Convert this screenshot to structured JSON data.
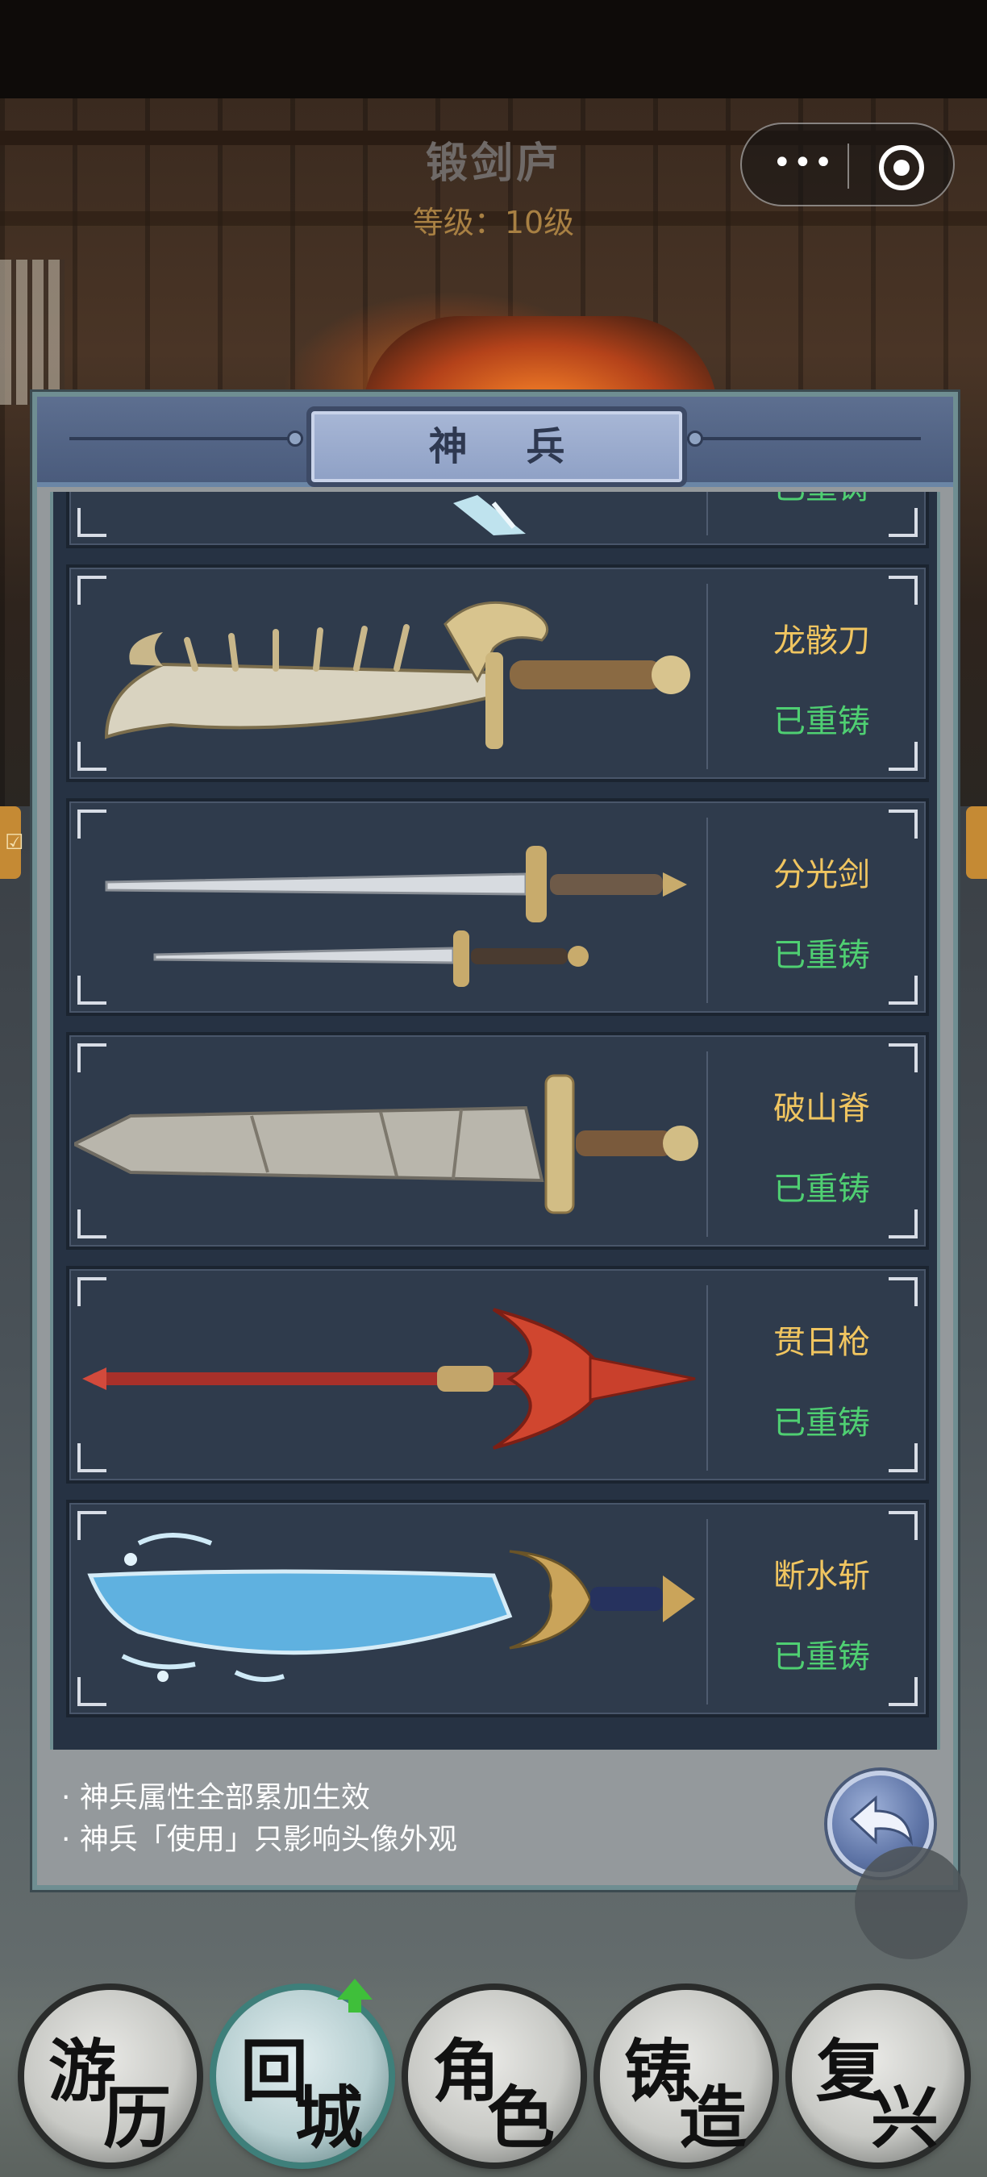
{
  "header": {
    "title": "锻剑庐",
    "level_text": "等级：10级"
  },
  "capsule": {
    "more_icon": "more-dots-icon",
    "close_icon": "target-circle-icon",
    "more_text": "•••"
  },
  "panel": {
    "title": "神 兵",
    "weapons": [
      {
        "name": "",
        "status": "已重铸",
        "icon": "partial-weapon-icon"
      },
      {
        "name": "龙骸刀",
        "status": "已重铸",
        "icon": "dragon-bone-blade-icon"
      },
      {
        "name": "分光剑",
        "status": "已重铸",
        "icon": "twin-swords-icon"
      },
      {
        "name": "破山脊",
        "status": "已重铸",
        "icon": "stone-greatsword-icon"
      },
      {
        "name": "贯日枪",
        "status": "已重铸",
        "icon": "red-spear-icon"
      },
      {
        "name": "断水斩",
        "status": "已重铸",
        "icon": "water-blade-icon"
      }
    ],
    "notes": [
      "· 神兵属性全部累加生效",
      "· 神兵「使用」只影响头像外观"
    ],
    "back_icon": "back-arrow-icon"
  },
  "bottom_nav": [
    {
      "char1": "游",
      "char2": "历"
    },
    {
      "char1": "回",
      "char2": "城",
      "badge": "up-arrow-icon"
    },
    {
      "char1": "角",
      "char2": "色"
    },
    {
      "char1": "铸",
      "char2": "造"
    },
    {
      "char1": "复",
      "char2": "兴"
    }
  ],
  "colors": {
    "weapon_name": "#f0c560",
    "status_green": "#4fcf72",
    "panel_header": "#5d6f90"
  }
}
